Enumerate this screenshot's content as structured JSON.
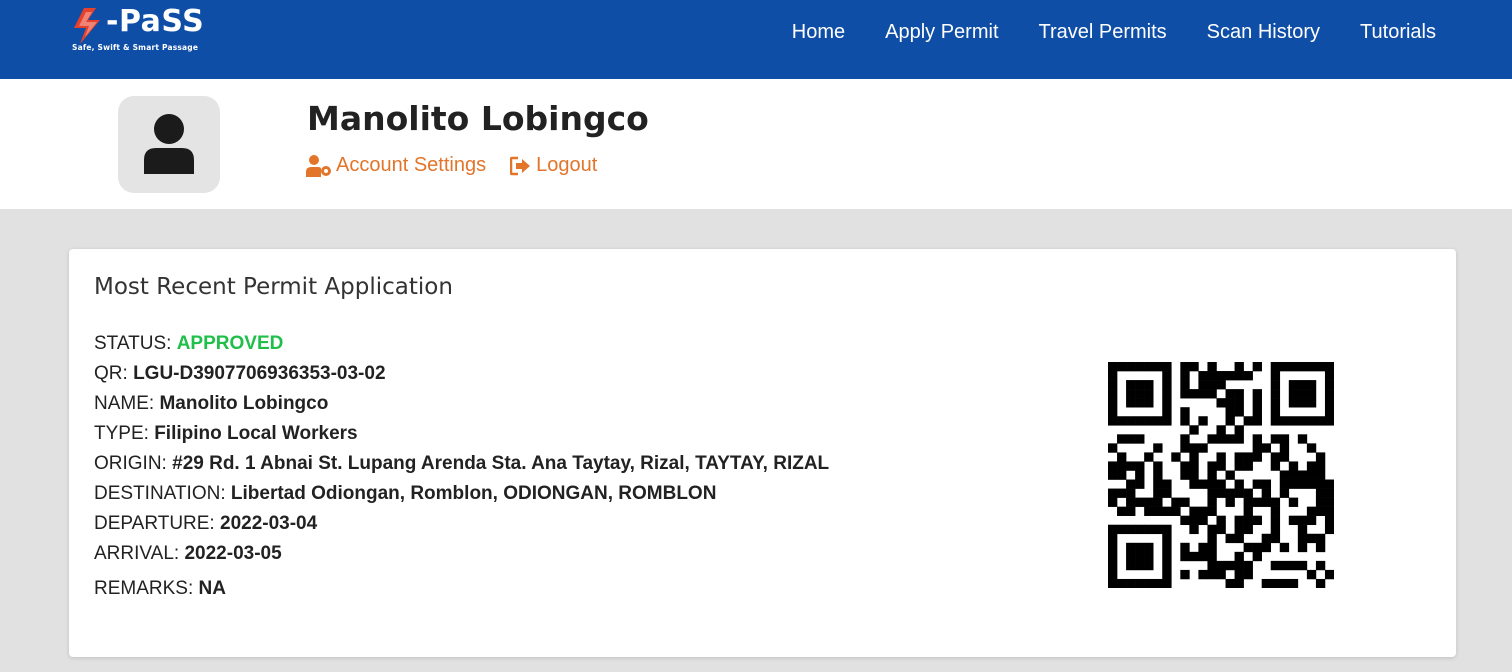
{
  "brand": {
    "name": "-PaSS",
    "tagline": "Safe, Swift & Smart Passage",
    "accent": "#e8412b"
  },
  "nav": {
    "items": [
      {
        "label": "Home",
        "name": "nav-home"
      },
      {
        "label": "Apply Permit",
        "name": "nav-apply-permit"
      },
      {
        "label": "Travel Permits",
        "name": "nav-travel-permits"
      },
      {
        "label": "Scan History",
        "name": "nav-scan-history"
      },
      {
        "label": "Tutorials",
        "name": "nav-tutorials"
      }
    ],
    "background": "#0f4ea6"
  },
  "profile": {
    "name": "Manolito Lobingco",
    "account_settings_label": "Account Settings",
    "logout_label": "Logout",
    "link_color": "#e2752a"
  },
  "permit": {
    "title": "Most Recent Permit Application",
    "status_label": "STATUS:",
    "status_value": "APPROVED",
    "status_color": "#1fbf4a",
    "qr_label": "QR:",
    "qr_value": "LGU-D3907706936353-03-02",
    "name_label": "NAME:",
    "name_value": "Manolito Lobingco",
    "type_label": "TYPE:",
    "type_value": "Filipino Local Workers",
    "origin_label": "ORIGIN:",
    "origin_value": "#29 Rd. 1 Abnai St. Lupang Arenda Sta. Ana Taytay, Rizal, TAYTAY, RIZAL",
    "destination_label": "DESTINATION:",
    "destination_value": "Libertad Odiongan, Romblon, ODIONGAN, ROMBLON",
    "departure_label": "DEPARTURE:",
    "departure_value": "2022-03-04",
    "arrival_label": "ARRIVAL:",
    "arrival_value": "2022-03-05",
    "remarks_label": "REMARKS:",
    "remarks_value": "NA"
  }
}
